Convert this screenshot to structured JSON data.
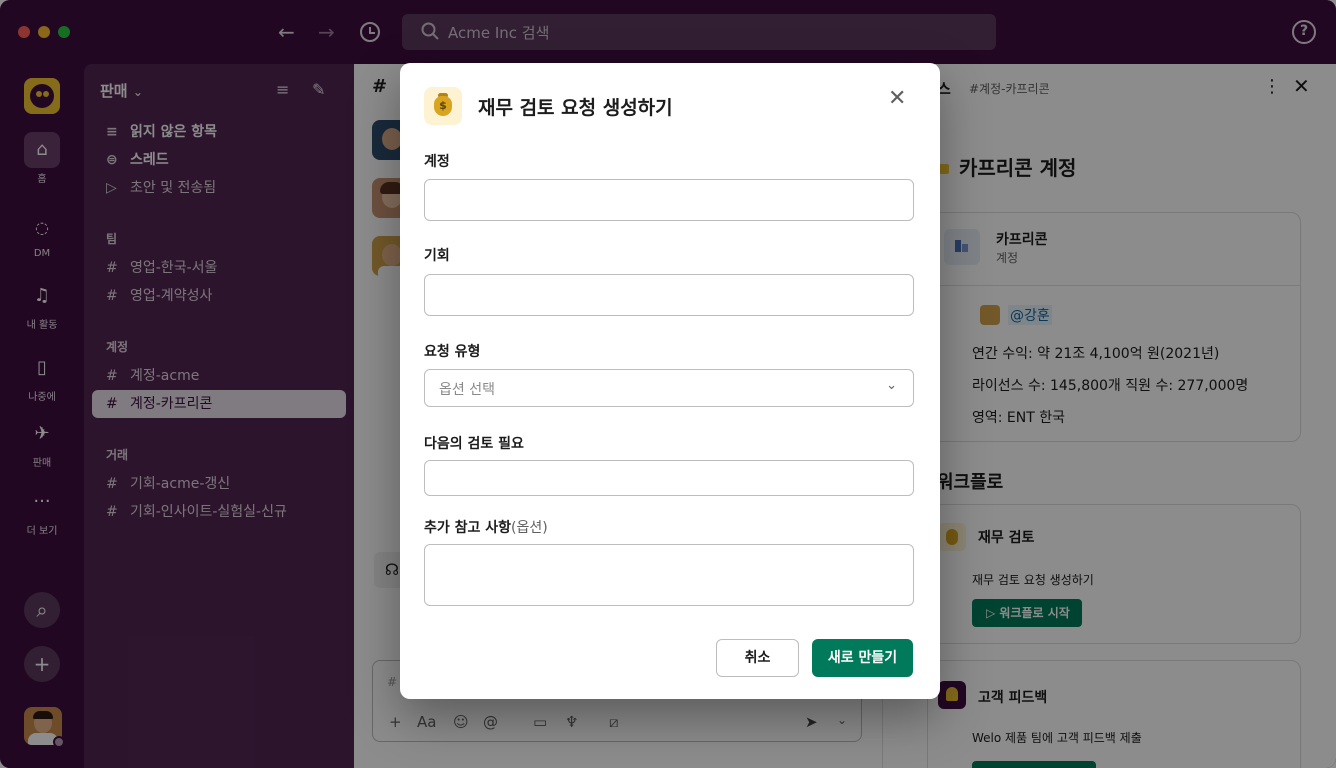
{
  "topbar": {
    "search_placeholder": "Acme Inc 검색",
    "back_icon": "arrow-left-icon",
    "forward_icon": "arrow-right-icon",
    "history_icon": "clock-icon",
    "help_label": "?"
  },
  "rail": {
    "items": [
      {
        "label": "홈",
        "icon": "home-icon"
      },
      {
        "label": "DM",
        "icon": "dm-icon"
      },
      {
        "label": "내 활동",
        "icon": "bell-icon"
      },
      {
        "label": "나중에",
        "icon": "bookmark-icon"
      },
      {
        "label": "판매",
        "icon": "rocket-icon"
      },
      {
        "label": "더 보기",
        "icon": "more-icon"
      }
    ]
  },
  "sidebar": {
    "title": "판매",
    "top_items": [
      {
        "label": "읽지 않은 항목"
      },
      {
        "label": "스레드"
      },
      {
        "label": "초안 및 전송됨"
      }
    ],
    "sections": [
      {
        "title": "팀",
        "channels": [
          "영업-한국-서울",
          "영업-계약성사"
        ]
      },
      {
        "title": "계정",
        "channels": [
          "계정-acme",
          "계정-카프리콘"
        ]
      },
      {
        "title": "거래",
        "channels": [
          "기회-acme-갱신",
          "기회-인사이트-실험실-신규"
        ]
      }
    ],
    "active_channel": "계정-카프리콘"
  },
  "center": {
    "channel_hash": "#",
    "composer_hint": "#"
  },
  "right_panel": {
    "header_title": "스",
    "header_channel": "#계정-카프리콘",
    "heading": "카프리콘 계정",
    "account": {
      "name": "카프리콘",
      "type": "계정"
    },
    "owner_mention": "@강훈",
    "info_lines": [
      "연간 수익: 약 21조 4,100억 원(2021년)",
      "라이선스 수: 145,800개   직원 수: 277,000명",
      "영역: ENT 한국"
    ],
    "workflow_heading": "워크플로",
    "workflows": [
      {
        "title": "재무 검토",
        "desc": "재무 검토 요청 생성하기",
        "button": "워크플로 시작"
      },
      {
        "title": "고객 피드백",
        "desc": "Welo 제품 팀에 고객 피드백 제출",
        "button": ""
      }
    ]
  },
  "modal": {
    "title": "재무 검토 요청 생성하기",
    "fields": [
      {
        "label": "계정",
        "value": ""
      },
      {
        "label": "기회",
        "value": ""
      },
      {
        "label": "요청 유형",
        "placeholder": "옵션 선택"
      },
      {
        "label": "다음의 검토 필요",
        "value": ""
      },
      {
        "label": "추가 참고 사항",
        "optional": "(옵션)",
        "value": ""
      }
    ],
    "cancel_label": "취소",
    "create_label": "새로 만들기"
  },
  "colors": {
    "aubergine": "#3f0e40",
    "sidebar": "#522653",
    "primary_green": "#007a5a",
    "mention_blue": "#1264a3"
  }
}
